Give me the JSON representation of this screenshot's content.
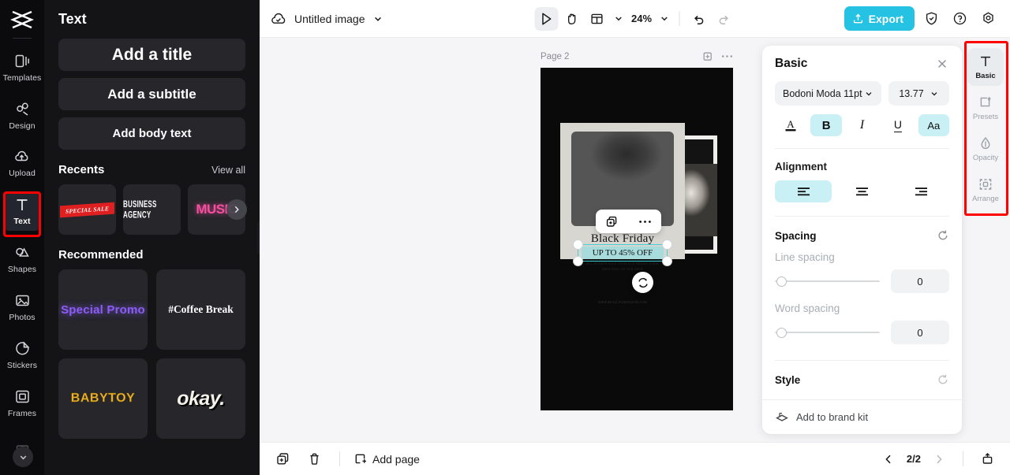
{
  "left_rail": {
    "logo_icon": "capcut-logo-icon",
    "items": [
      {
        "label": "Templates",
        "icon": "templates-icon",
        "active": false
      },
      {
        "label": "Design",
        "icon": "design-icon",
        "active": false
      },
      {
        "label": "Upload",
        "icon": "upload-cloud-icon",
        "active": false
      },
      {
        "label": "Text",
        "icon": "text-t-icon",
        "active": true
      },
      {
        "label": "Shapes",
        "icon": "shapes-icon",
        "active": false
      },
      {
        "label": "Photos",
        "icon": "photo-icon",
        "active": false
      },
      {
        "label": "Stickers",
        "icon": "sticker-icon",
        "active": false
      },
      {
        "label": "Frames",
        "icon": "frames-icon",
        "active": false
      }
    ],
    "more_icon": "chevron-down-icon",
    "highlight_color": "#ff0000"
  },
  "text_panel": {
    "title": "Text",
    "buttons": [
      {
        "label": "Add a title"
      },
      {
        "label": "Add a subtitle"
      },
      {
        "label": "Add body text"
      }
    ],
    "recents": {
      "title": "Recents",
      "view_all": "View all",
      "items": [
        {
          "label": "SPECIAL SALE",
          "style": "special"
        },
        {
          "label": "BUSINESS AGENCY",
          "style": "business"
        },
        {
          "label": "MUSIC",
          "style": "music"
        }
      ],
      "next_icon": "chevron-right-icon"
    },
    "recommended": {
      "title": "Recommended",
      "items": [
        {
          "label": "Special Promo",
          "style": "promo"
        },
        {
          "label": "#Coffee Break",
          "style": "coffee"
        },
        {
          "label": "BABYTOY",
          "style": "baby"
        },
        {
          "label": "okay.",
          "style": "okay"
        }
      ]
    },
    "collapse_icon": "chevron-left-icon"
  },
  "topbar": {
    "cloud_icon": "cloud-saved-icon",
    "doc_name": "Untitled image",
    "doc_caret_icon": "chevron-down-icon",
    "tools": [
      {
        "name": "select-tool",
        "icon": "cursor-arrow-icon",
        "selected": true
      },
      {
        "name": "hand-tool",
        "icon": "hand-icon",
        "selected": false
      },
      {
        "name": "layout-tool",
        "icon": "layout-grid-icon",
        "selected": false
      }
    ],
    "layout_caret_icon": "chevron-down-icon",
    "zoom": "24%",
    "zoom_caret_icon": "chevron-down-icon",
    "undo_icon": "undo-arrow-icon",
    "redo_icon": "redo-arrow-icon",
    "export_label": "Export",
    "export_icon": "export-upload-icon",
    "export_color": "#25c2e3",
    "shield_icon": "shield-check-icon",
    "help_icon": "question-circle-icon",
    "settings_icon": "gear-icon"
  },
  "canvas": {
    "page_label": "Page 2",
    "duplicate_icon": "duplicate-page-icon",
    "more_icon": "more-dots-icon",
    "design": {
      "title": "Black Friday",
      "subtitle": "UP TO 45% OFF",
      "body": "ALL SEASON SALE ON BLACK\nFRIDAY WEEK\nSHOP NOW ON OUR SHOP",
      "footer": "WWW.REALLYGREATSITE.COM"
    },
    "selection": {
      "handle_icon": "resize-handle",
      "accent_color": "#3fd0d8"
    },
    "context_bar": {
      "duplicate_icon": "duplicate-icon",
      "more_icon": "more-dots-icon"
    },
    "refresh_icon": "refresh-replace-icon"
  },
  "bottombar": {
    "duplicate_icon": "duplicate-page-icon",
    "delete_icon": "trash-icon",
    "add_page_label": "Add page",
    "add_page_icon": "add-page-icon",
    "prev_icon": "chevron-left-icon",
    "page_count": "2/2",
    "next_icon": "chevron-right-icon",
    "present_icon": "present-icon"
  },
  "properties": {
    "title": "Basic",
    "close_icon": "close-icon",
    "font_family": "Bodoni Moda 11pt",
    "font_caret_icon": "chevron-down-icon",
    "font_size": "13.77",
    "size_caret_icon": "chevron-down-icon",
    "style_buttons": [
      {
        "name": "text-color-button",
        "glyph": "A",
        "active": false
      },
      {
        "name": "bold-button",
        "glyph": "B",
        "active": true
      },
      {
        "name": "italic-button",
        "glyph": "I",
        "active": false
      },
      {
        "name": "underline-button",
        "glyph": "U",
        "active": false
      },
      {
        "name": "case-button",
        "glyph": "Aa",
        "active": true
      }
    ],
    "alignment_label": "Alignment",
    "alignment": [
      {
        "name": "align-left-button",
        "active": true
      },
      {
        "name": "align-center-button",
        "active": false
      },
      {
        "name": "align-right-button",
        "active": false
      }
    ],
    "spacing_label": "Spacing",
    "spacing_reset_icon": "reset-icon",
    "line_spacing_label": "Line spacing",
    "line_spacing_value": "0",
    "word_spacing_label": "Word spacing",
    "word_spacing_value": "0",
    "style_label": "Style",
    "style_reset_icon": "reset-icon",
    "brand_kit_label": "Add to brand kit",
    "brand_kit_icon": "brand-kit-icon",
    "active_accent": "#c9f0f5"
  },
  "right_rail": {
    "items": [
      {
        "label": "Basic",
        "icon": "text-t-icon",
        "active": true
      },
      {
        "label": "Presets",
        "icon": "presets-icon",
        "active": false
      },
      {
        "label": "Opacity",
        "icon": "opacity-drop-icon",
        "active": false
      },
      {
        "label": "Arrange",
        "icon": "arrange-icon",
        "active": false
      }
    ],
    "highlight_color": "#ff0000"
  }
}
